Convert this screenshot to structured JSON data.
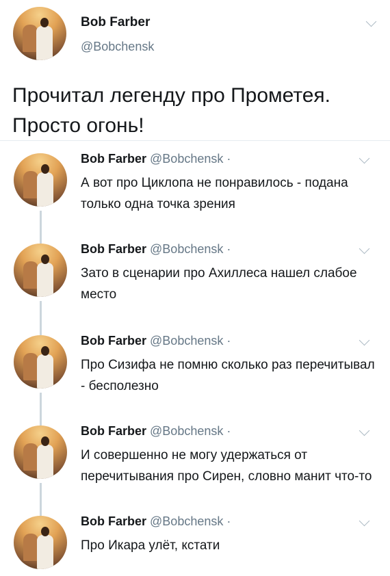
{
  "main_tweet": {
    "author_name": "Bob Farber",
    "author_handle": "@Bobchensk",
    "text": "Прочитал легенду про Прометея. Просто огонь!"
  },
  "replies": [
    {
      "author_name": "Bob Farber",
      "author_handle": "@Bobchensk",
      "separator": "·",
      "text": "А вот про Циклопа не понравилось - подана только одна точка зрения"
    },
    {
      "author_name": "Bob Farber",
      "author_handle": "@Bobchensk",
      "separator": "·",
      "text": "Зато в сценарии про Ахиллеса нашел слабое место"
    },
    {
      "author_name": "Bob Farber",
      "author_handle": "@Bobchensk",
      "separator": "·",
      "text": "Про Сизифа не помню сколько раз перечитывал - бесполезно"
    },
    {
      "author_name": "Bob Farber",
      "author_handle": "@Bobchensk",
      "separator": "·",
      "text": "И совершенно не могу удержаться от перечитывания про Сирен, словно манит что-то"
    },
    {
      "author_name": "Bob Farber",
      "author_handle": "@Bobchensk",
      "separator": "·",
      "text": "Про Икара улёт, кстати"
    }
  ],
  "icons": {
    "menu": "chevron-down-icon",
    "avatar": "avatar"
  },
  "colors": {
    "text": "#14171a",
    "secondary_text": "#657786",
    "thread_line": "#ccd6dd",
    "divider": "#e6ecf0"
  }
}
